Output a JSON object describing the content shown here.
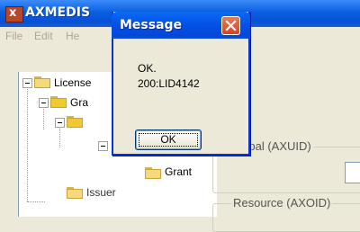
{
  "main_window": {
    "title": "AXMEDIS",
    "icon": "axmedis-logo-icon",
    "colors": {
      "title_bar": "#0551d8",
      "face": "#ece9d8"
    }
  },
  "menu": {
    "items": [
      "File",
      "Edit",
      "He"
    ]
  },
  "tree": {
    "nodes": [
      {
        "label": "License",
        "icon": "folder-icon",
        "expanded": true
      },
      {
        "label": "Gra",
        "icon": "folder-open-icon",
        "expanded": true
      },
      {
        "label": "",
        "icon": "folder-open-icon",
        "expanded": true
      },
      {
        "label": "",
        "icon": "folder-icon",
        "expanded": true
      },
      {
        "label": "Grant",
        "icon": "folder-icon"
      },
      {
        "label": "Issuer",
        "icon": "folder-icon"
      }
    ]
  },
  "panel": {
    "principal_label": "cipal (AXUID)",
    "principal_value": "",
    "resource_label": "Resource (AXOID)"
  },
  "dialog": {
    "title": "Message",
    "message_line1": "OK.",
    "message_line2": "200:LID4142",
    "ok_label": "OK",
    "close_color": "#d24525"
  }
}
